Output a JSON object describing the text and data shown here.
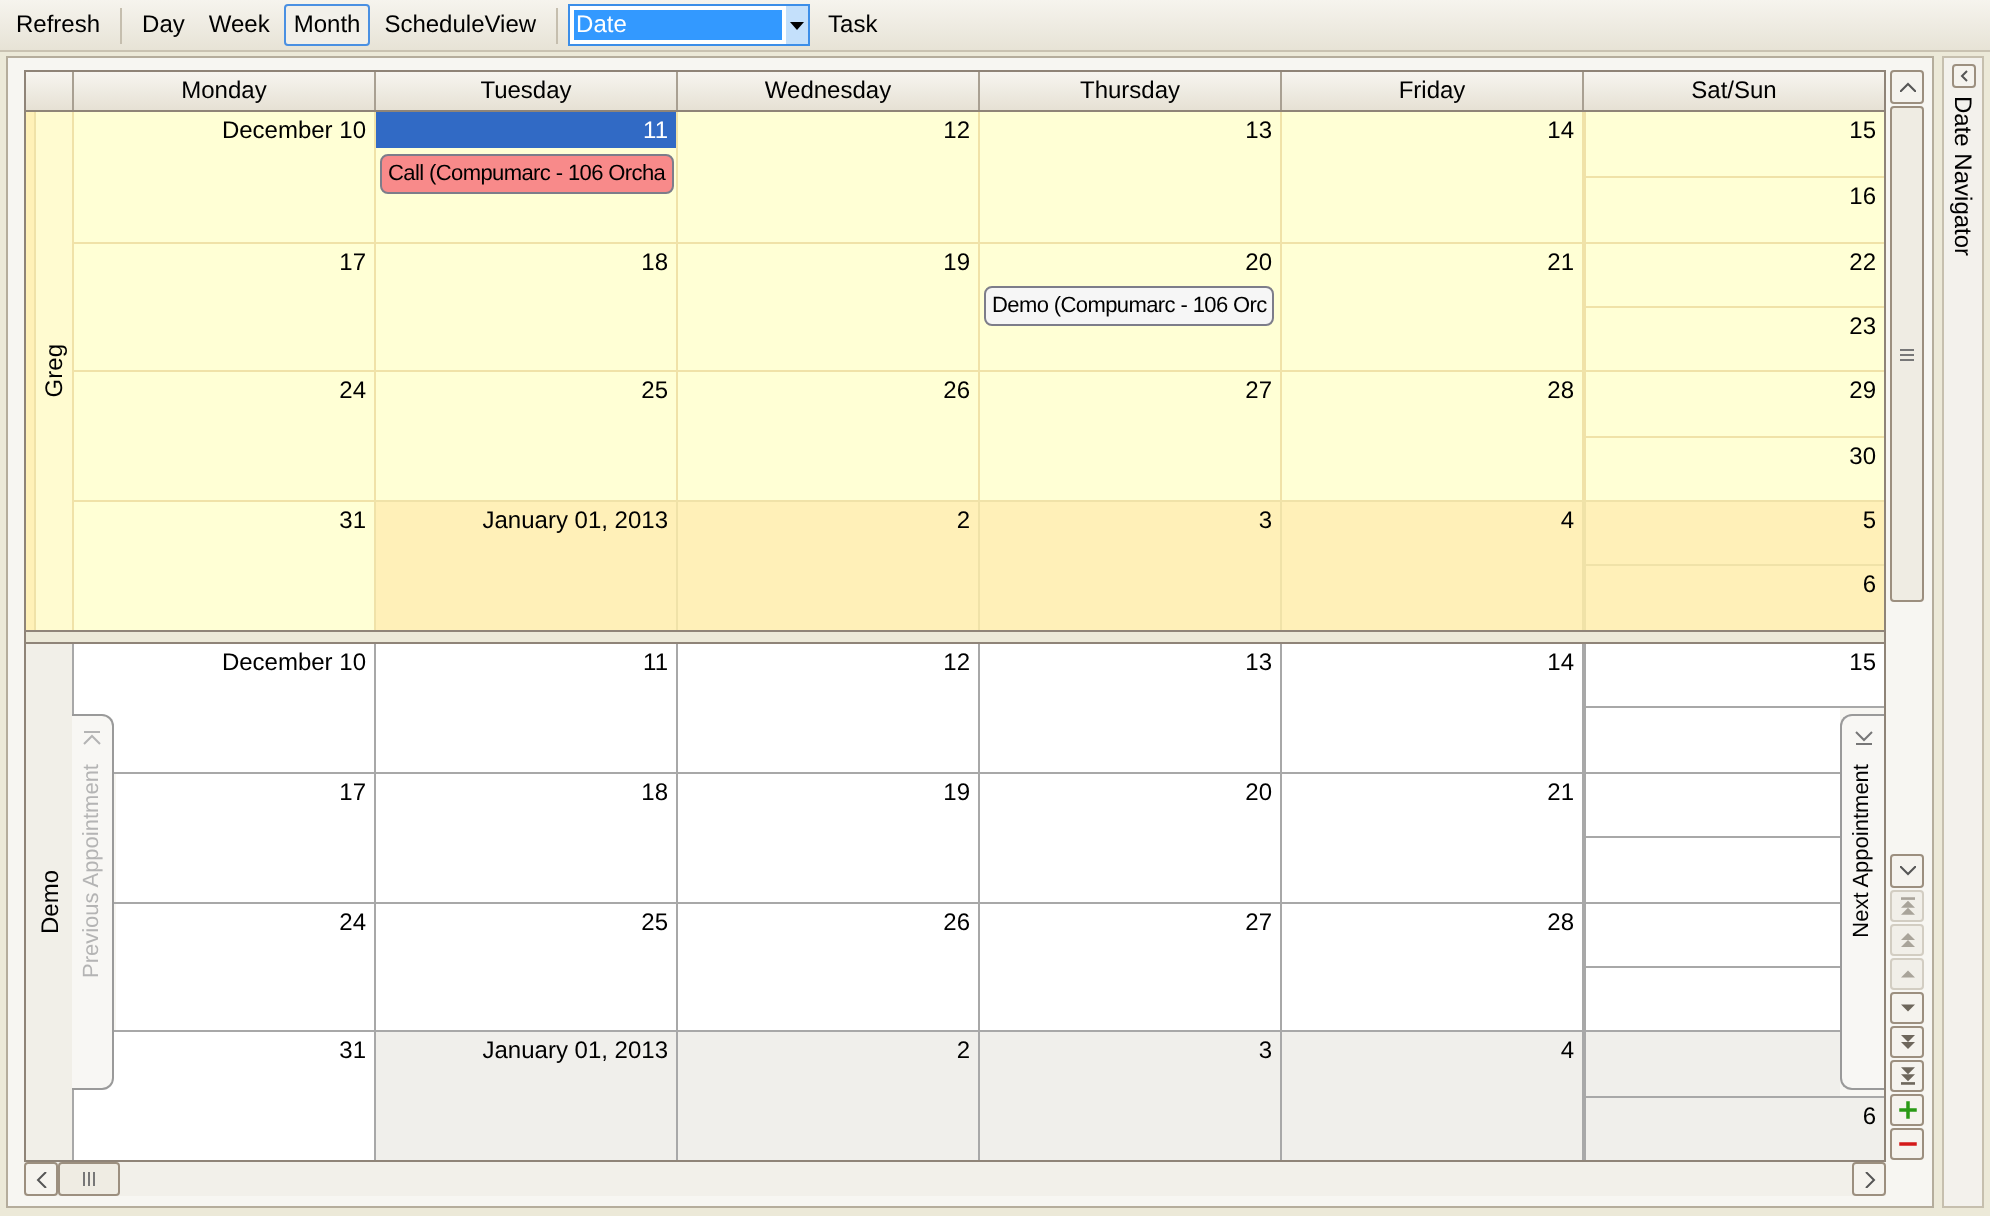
{
  "toolbar": {
    "refresh": "Refresh",
    "views": [
      {
        "label": "Day",
        "selected": false
      },
      {
        "label": "Week",
        "selected": false
      },
      {
        "label": "Month",
        "selected": true
      },
      {
        "label": "ScheduleView",
        "selected": false
      }
    ],
    "dropdown": {
      "value": "Date",
      "focused": true
    },
    "task": "Task"
  },
  "calendar": {
    "columns": [
      "Monday",
      "Tuesday",
      "Wednesday",
      "Thursday",
      "Friday",
      "Sat/Sun"
    ],
    "resources": [
      {
        "name": "Greg",
        "kind": "highlighted",
        "weeks": [
          {
            "days": [
              {
                "label": "December 10",
                "other_month": false,
                "selected": false
              },
              {
                "label": "11",
                "other_month": false,
                "selected": true,
                "appointments": [
                  {
                    "text": "Call (Compumarc - 106 Orcha",
                    "color": "#f88a8a"
                  }
                ]
              },
              {
                "label": "12",
                "other_month": false,
                "selected": false
              },
              {
                "label": "13",
                "other_month": false,
                "selected": false
              },
              {
                "label": "14",
                "other_month": false,
                "selected": false
              }
            ],
            "weekend": [
              {
                "label": "15",
                "other_month": false,
                "selected": false
              },
              {
                "label": "16",
                "other_month": false,
                "selected": false
              }
            ]
          },
          {
            "days": [
              {
                "label": "17",
                "other_month": false,
                "selected": false
              },
              {
                "label": "18",
                "other_month": false,
                "selected": false
              },
              {
                "label": "19",
                "other_month": false,
                "selected": false
              },
              {
                "label": "20",
                "other_month": false,
                "selected": false,
                "appointments": [
                  {
                    "text": "Demo (Compumarc - 106 Orc",
                    "color": "#f6f6f6"
                  }
                ]
              },
              {
                "label": "21",
                "other_month": false,
                "selected": false
              }
            ],
            "weekend": [
              {
                "label": "22",
                "other_month": false,
                "selected": false
              },
              {
                "label": "23",
                "other_month": false,
                "selected": false
              }
            ]
          },
          {
            "days": [
              {
                "label": "24",
                "other_month": false,
                "selected": false
              },
              {
                "label": "25",
                "other_month": false,
                "selected": false
              },
              {
                "label": "26",
                "other_month": false,
                "selected": false
              },
              {
                "label": "27",
                "other_month": false,
                "selected": false
              },
              {
                "label": "28",
                "other_month": false,
                "selected": false
              }
            ],
            "weekend": [
              {
                "label": "29",
                "other_month": false,
                "selected": false
              },
              {
                "label": "30",
                "other_month": false,
                "selected": false
              }
            ]
          },
          {
            "days": [
              {
                "label": "31",
                "other_month": false,
                "selected": false
              },
              {
                "label": "January 01, 2013",
                "other_month": true,
                "selected": false
              },
              {
                "label": "2",
                "other_month": true,
                "selected": false
              },
              {
                "label": "3",
                "other_month": true,
                "selected": false
              },
              {
                "label": "4",
                "other_month": true,
                "selected": false
              }
            ],
            "weekend": [
              {
                "label": "5",
                "other_month": true,
                "selected": false
              },
              {
                "label": "6",
                "other_month": true,
                "selected": false
              }
            ]
          }
        ]
      },
      {
        "name": "Demo",
        "kind": "plain",
        "navigation": {
          "previous": {
            "label": "Previous Appointment",
            "disabled": true
          },
          "next": {
            "label": "Next Appointment",
            "disabled": false
          }
        },
        "weeks": [
          {
            "days": [
              {
                "label": "December 10",
                "other_month": false,
                "selected": false
              },
              {
                "label": "11",
                "other_month": false,
                "selected": false
              },
              {
                "label": "12",
                "other_month": false,
                "selected": false
              },
              {
                "label": "13",
                "other_month": false,
                "selected": false
              },
              {
                "label": "14",
                "other_month": false,
                "selected": false
              }
            ],
            "weekend": [
              {
                "label": "15",
                "other_month": false,
                "selected": false
              },
              {
                "other_month": false,
                "selected": false
              }
            ]
          },
          {
            "days": [
              {
                "label": "17",
                "other_month": false,
                "selected": false
              },
              {
                "label": "18",
                "other_month": false,
                "selected": false
              },
              {
                "label": "19",
                "other_month": false,
                "selected": false
              },
              {
                "label": "20",
                "other_month": false,
                "selected": false
              },
              {
                "label": "21",
                "other_month": false,
                "selected": false
              }
            ],
            "weekend": [
              {
                "other_month": false,
                "selected": false
              },
              {
                "other_month": false,
                "selected": false
              }
            ]
          },
          {
            "days": [
              {
                "label": "24",
                "other_month": false,
                "selected": false
              },
              {
                "label": "25",
                "other_month": false,
                "selected": false
              },
              {
                "label": "26",
                "other_month": false,
                "selected": false
              },
              {
                "label": "27",
                "other_month": false,
                "selected": false
              },
              {
                "label": "28",
                "other_month": false,
                "selected": false
              }
            ],
            "weekend": [
              {
                "other_month": false,
                "selected": false
              },
              {
                "other_month": false,
                "selected": false
              }
            ]
          },
          {
            "days": [
              {
                "label": "31",
                "other_month": false,
                "selected": false
              },
              {
                "label": "January 01, 2013",
                "other_month": true,
                "selected": false
              },
              {
                "label": "2",
                "other_month": true,
                "selected": false
              },
              {
                "label": "3",
                "other_month": true,
                "selected": false
              },
              {
                "label": "4",
                "other_month": true,
                "selected": false
              }
            ],
            "weekend": [
              {
                "other_month": true,
                "selected": false
              },
              {
                "label": "6",
                "other_month": true,
                "selected": false
              }
            ]
          }
        ]
      }
    ],
    "nav_buttons": [
      {
        "kind": "first",
        "disabled": true
      },
      {
        "kind": "page-up",
        "disabled": true
      },
      {
        "kind": "up",
        "disabled": true
      },
      {
        "kind": "down",
        "disabled": false
      },
      {
        "kind": "page-down",
        "disabled": false
      },
      {
        "kind": "last",
        "disabled": false
      },
      {
        "kind": "add",
        "disabled": false
      },
      {
        "kind": "remove",
        "disabled": false
      }
    ]
  },
  "date_navigator": {
    "label": "Date Navigator"
  }
}
